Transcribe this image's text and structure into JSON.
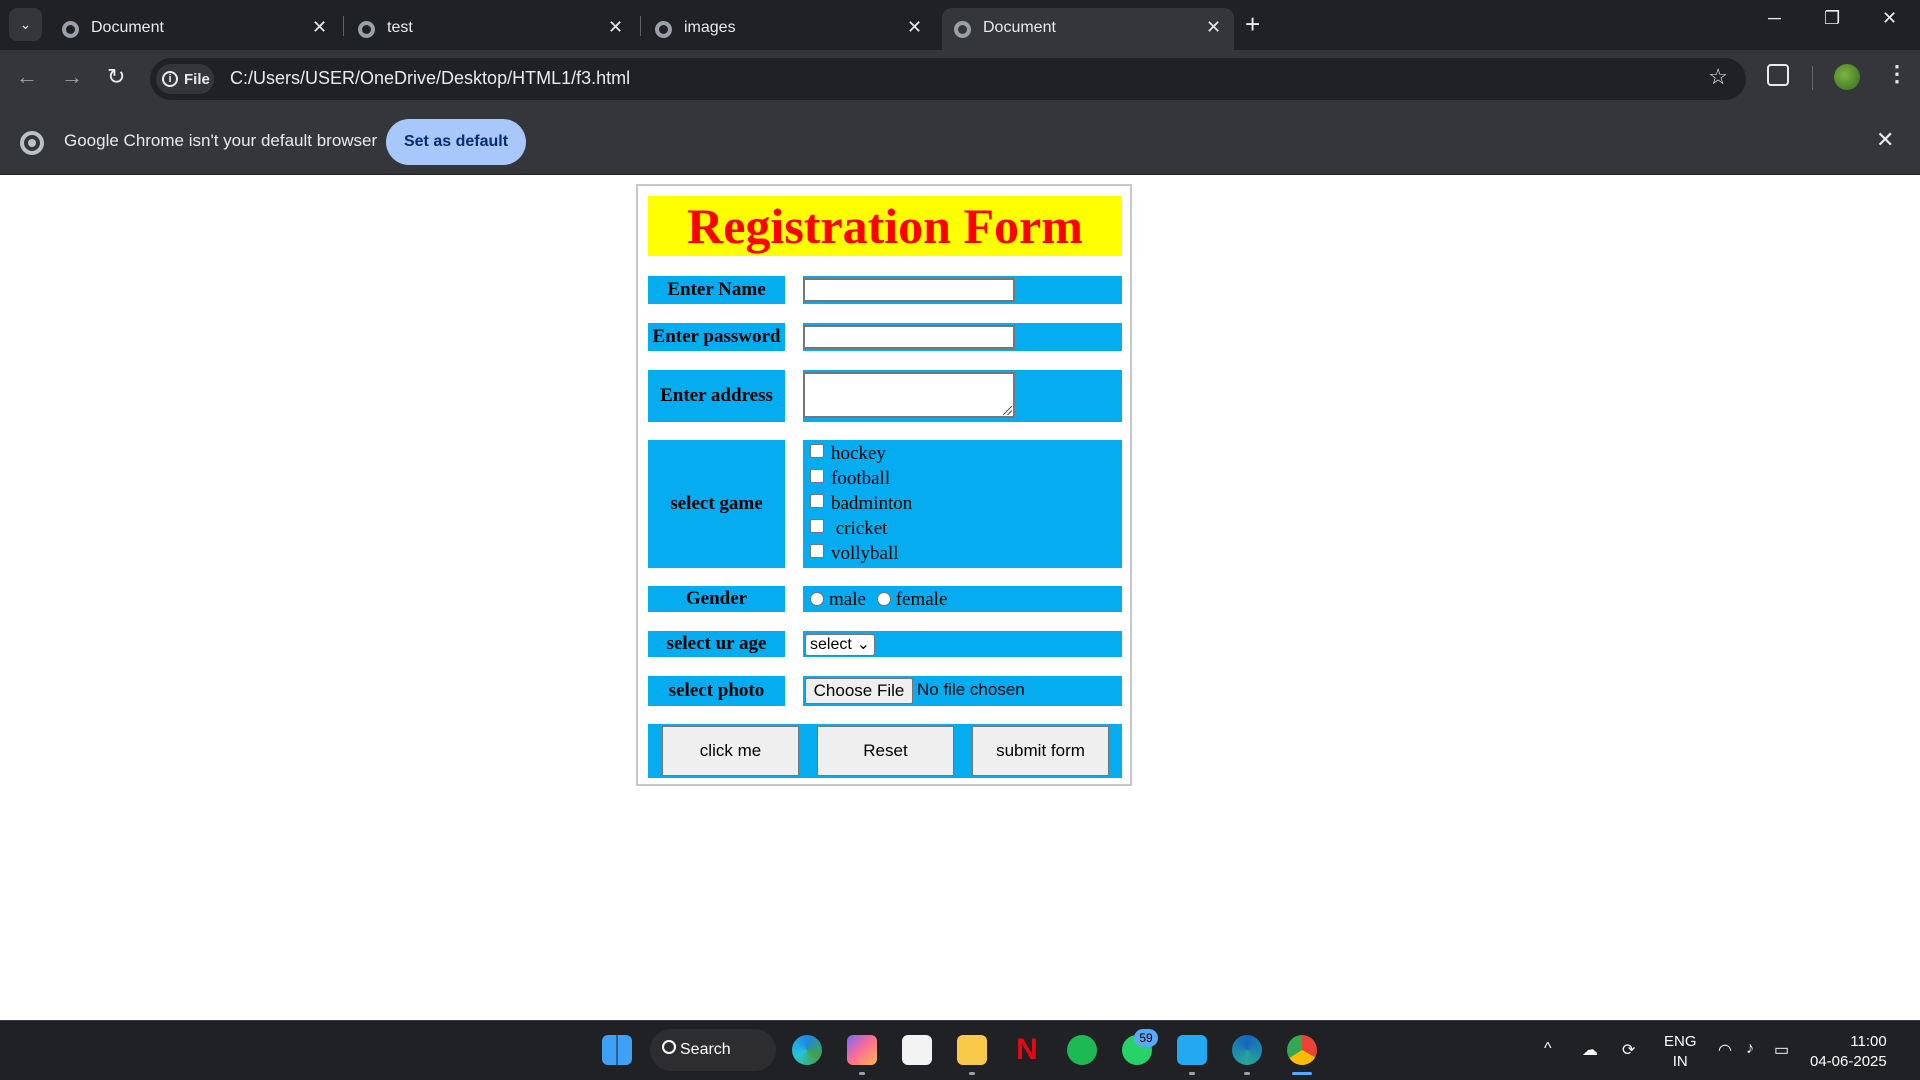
{
  "browser": {
    "tabs": [
      {
        "title": "Document",
        "active": false
      },
      {
        "title": "test",
        "active": false
      },
      {
        "title": "images",
        "active": false
      },
      {
        "title": "Document",
        "active": true
      }
    ],
    "new_tab": "+",
    "tabs_menu": "⌄",
    "window_controls": {
      "minimize": "─",
      "restore": "❐",
      "close": "✕"
    },
    "nav": {
      "back": "←",
      "forward": "→",
      "reload": "↻"
    },
    "site_chip": "File",
    "url": "C:/Users/USER/OneDrive/Desktop/HTML1/f3.html",
    "bookmark": "☆",
    "menu": "⋮",
    "infobar": {
      "message": "Google Chrome isn't your default browser",
      "button": "Set as default",
      "close": "✕"
    }
  },
  "form": {
    "title": "Registration Form",
    "name_label": "Enter Name",
    "password_label": "Enter password",
    "address_label": "Enter address",
    "game_label": "select game",
    "games": [
      "hockey",
      "football",
      "badminton",
      " cricket",
      "vollyball"
    ],
    "gender_label": "Gender",
    "genders": [
      "male",
      "female"
    ],
    "age_label": "select ur age",
    "age_select": "select",
    "photo_label": "select photo",
    "file_button": "Choose File",
    "file_status": "No file chosen",
    "buttons": [
      "click me",
      "Reset",
      "submit form"
    ],
    "colors": {
      "header_bg": "#ffff00",
      "header_text": "#ff0000",
      "cell_bg": "#05acef"
    }
  },
  "taskbar": {
    "search": "Search",
    "whatsapp_badge": "59",
    "icons": [
      "windows-start-icon",
      "edge-icon",
      "copilot-icon",
      "store-icon",
      "file-explorer-icon",
      "netflix-icon",
      "spotify-icon",
      "whatsapp-icon",
      "vscode-icon",
      "edge-dev-icon",
      "chrome-icon"
    ],
    "tray": {
      "chevron": "^",
      "lang_top": "ENG",
      "lang_bottom": "IN",
      "time": "11:00",
      "date": "04-06-2025"
    }
  }
}
